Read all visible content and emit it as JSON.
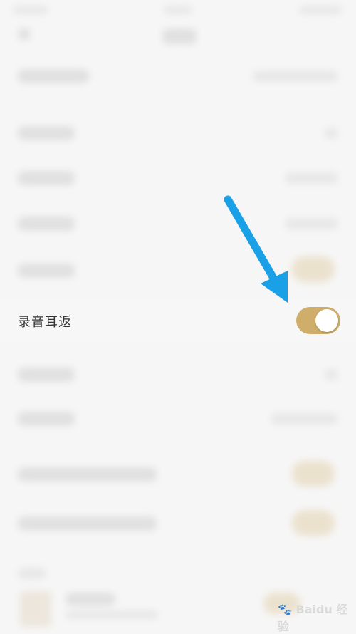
{
  "settings": {
    "focused_item": {
      "label": "录音耳返",
      "toggle_on": true,
      "accent_color": "#cfae6c"
    }
  },
  "annotation": {
    "arrow_color": "#1aa0e6",
    "points_to": "recording-monitor-toggle"
  },
  "watermark": {
    "text": "Baidu 经验",
    "icon": "paw-icon"
  }
}
